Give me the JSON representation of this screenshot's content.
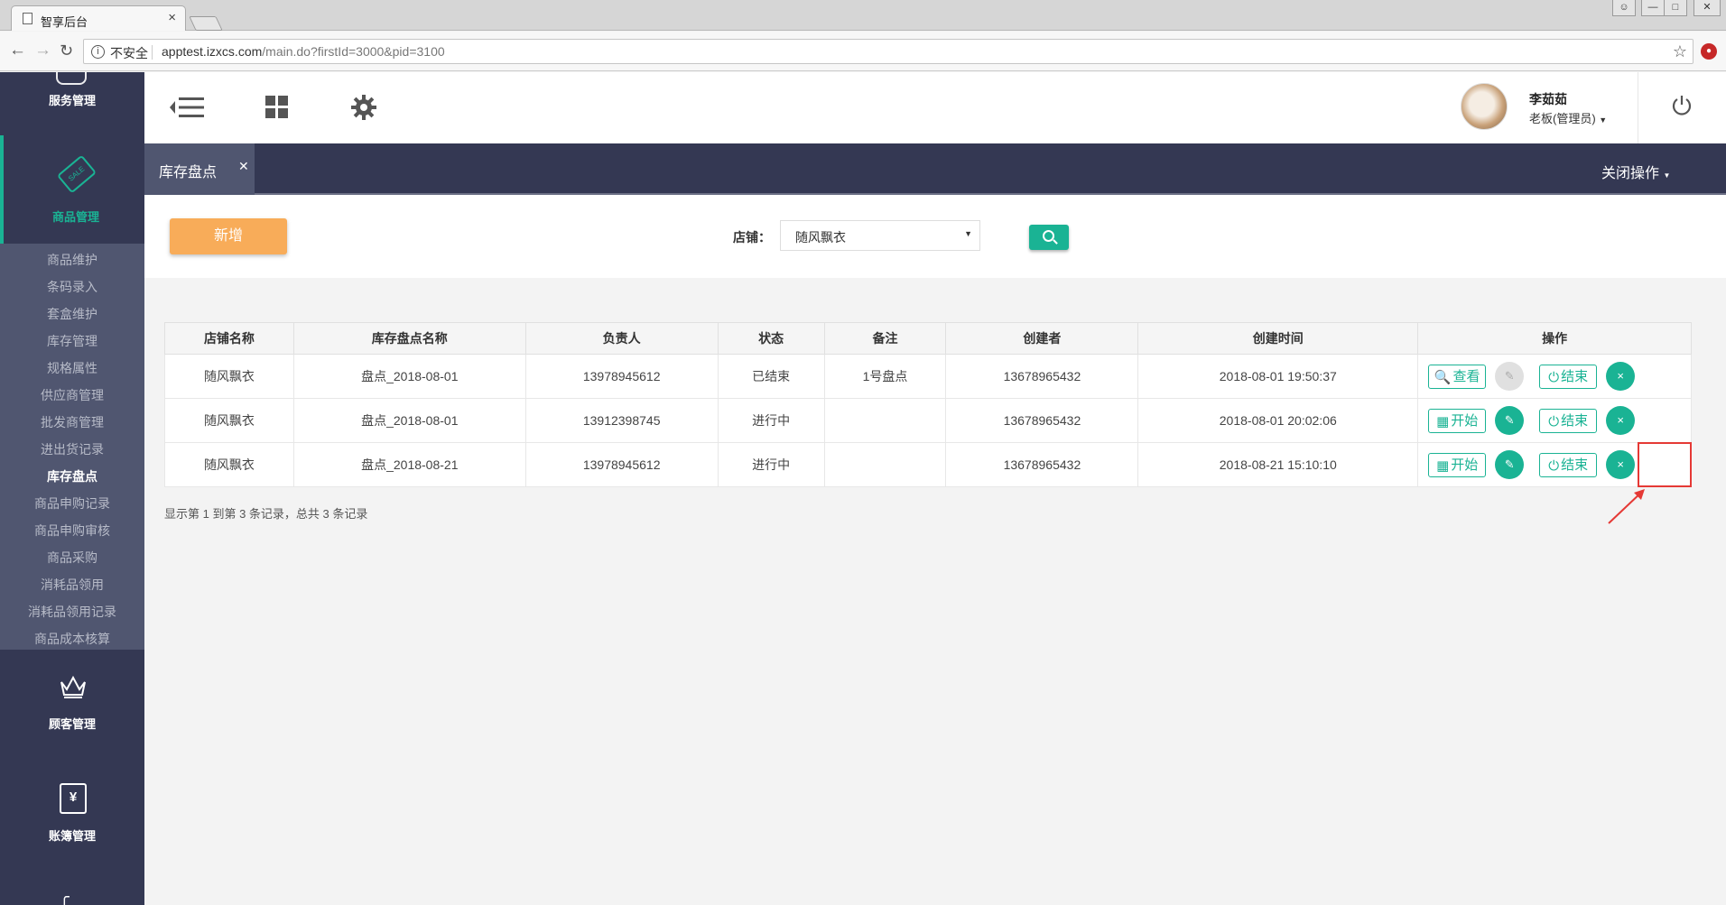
{
  "browser": {
    "tab_title": "智享后台",
    "tab_close": "×",
    "insecure_label": "不安全",
    "url_host": "apptest.izxcs.com",
    "url_path": "/main.do?firstId=3000&pid=3100"
  },
  "sidebar": {
    "top_label": "服务管理",
    "active_section": "商品管理",
    "sale_tag_text": "SALE",
    "submenu": [
      "商品维护",
      "条码录入",
      "套盒维护",
      "库存管理",
      "规格属性",
      "供应商管理",
      "批发商管理",
      "进出货记录",
      "库存盘点",
      "商品申购记录",
      "商品申购审核",
      "商品采购",
      "消耗品领用",
      "消耗品领用记录",
      "商品成本核算"
    ],
    "active_submenu": "库存盘点",
    "section_customer": "顾客管理",
    "section_accounts": "账簿管理",
    "book_icon_text": "¥"
  },
  "header": {
    "user_name": "李茹茹",
    "user_role": "老板(管理员)"
  },
  "tabs": {
    "active_tab": "库存盘点",
    "close_ops": "关闭操作"
  },
  "toolbar": {
    "add_button": "新增",
    "store_label": "店铺：",
    "store_value": "随风飘衣"
  },
  "table": {
    "headers": [
      "店铺名称",
      "库存盘点名称",
      "负责人",
      "状态",
      "备注",
      "创建者",
      "创建时间",
      "操作"
    ],
    "rows": [
      {
        "store": "随风飘衣",
        "name": "盘点_2018-08-01",
        "owner": "13978945612",
        "status": "已结束",
        "note": "1号盘点",
        "creator": "13678965432",
        "created": "2018-08-01 19:50:37",
        "primary_action": "查看"
      },
      {
        "store": "随风飘衣",
        "name": "盘点_2018-08-01",
        "owner": "13912398745",
        "status": "进行中",
        "note": "",
        "creator": "13678965432",
        "created": "2018-08-01 20:02:06",
        "primary_action": "开始"
      },
      {
        "store": "随风飘衣",
        "name": "盘点_2018-08-21",
        "owner": "13978945612",
        "status": "进行中",
        "note": "",
        "creator": "13678965432",
        "created": "2018-08-21 15:10:10",
        "primary_action": "开始"
      }
    ],
    "end_label": "结束",
    "delete_glyph": "×"
  },
  "footer": {
    "summary": "显示第 1 到第 3 条记录，总共 3 条记录"
  },
  "colors": {
    "accent": "#1ab394",
    "orange": "#f8ac59",
    "sidebar": "#343853",
    "highlight": "#e53935"
  }
}
